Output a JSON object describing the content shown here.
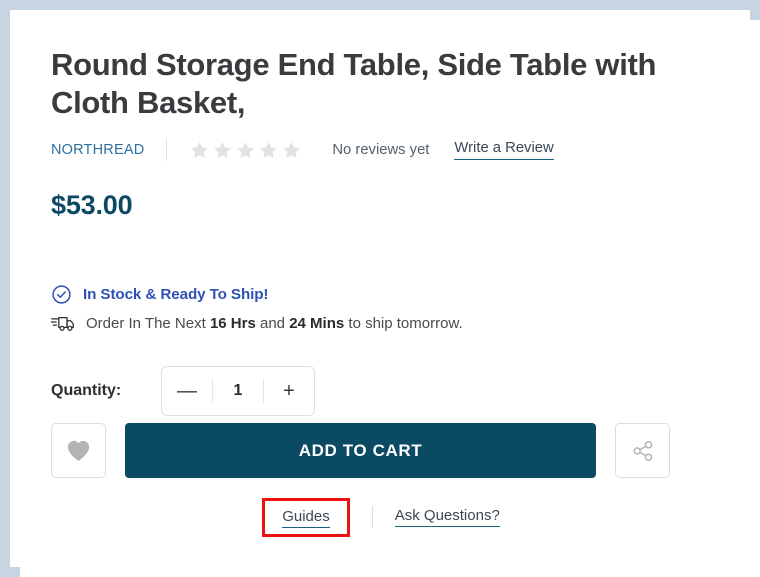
{
  "product": {
    "title": "Round Storage End Table, Side Table with Cloth Basket,",
    "brand": "NORTHREAD",
    "reviews_text": "No reviews yet",
    "write_review_label": "Write a Review",
    "rating_stars_empty": 5,
    "price": "$53.00"
  },
  "availability": {
    "stock_label": "In Stock & Ready To Ship!",
    "shipping_prefix": "Order In The Next ",
    "shipping_hours": "16 Hrs",
    "shipping_mid": " and ",
    "shipping_mins": "24 Mins",
    "shipping_suffix": " to ship tomorrow."
  },
  "quantity": {
    "label": "Quantity:",
    "decrease_label": "—",
    "value": "1",
    "increase_label": "+"
  },
  "actions": {
    "add_to_cart_label": "ADD TO CART",
    "wishlist_icon": "heart-icon",
    "share_icon": "share-icon"
  },
  "footer": {
    "guides_label": "Guides",
    "ask_questions_label": "Ask Questions?"
  },
  "colors": {
    "page_border": "#c7d4e1",
    "brand_link": "#2f6f9f",
    "price": "#0c4a64",
    "stock_blue": "#2f51b5",
    "cart_button": "#0a4a63",
    "link_underline": "#16637f",
    "star_empty": "#e2e2e2",
    "highlight_box": "#ee1111",
    "icon_gray": "#b4b4b4"
  }
}
